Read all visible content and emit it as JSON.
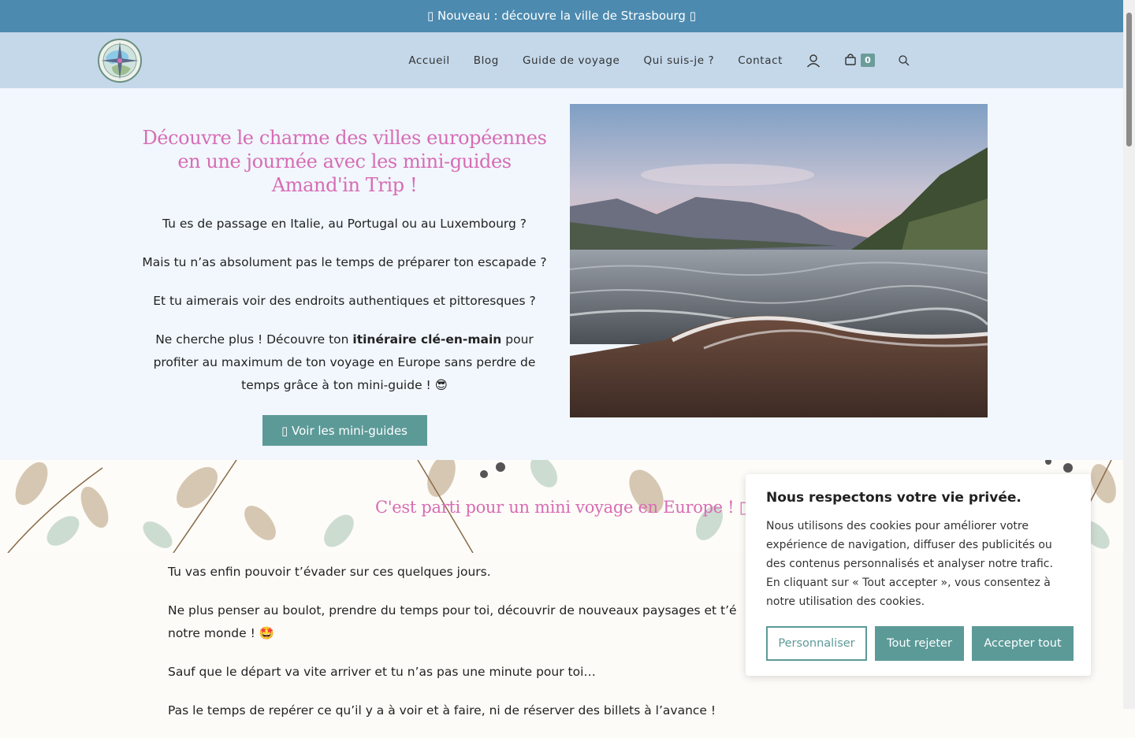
{
  "announcement": "▯ Nouveau : découvre la ville de Strasbourg ▯",
  "nav": {
    "items": [
      {
        "label": "Accueil"
      },
      {
        "label": "Blog"
      },
      {
        "label": "Guide de voyage"
      },
      {
        "label": "Qui suis-je ?"
      },
      {
        "label": "Contact"
      }
    ],
    "icons": [
      "user-icon",
      "cart-icon",
      "search-icon"
    ],
    "cart_count": "0"
  },
  "hero": {
    "title": "Découvre le charme des villes européennes en une journée avec les mini-guides Amand'in Trip !",
    "p1": "Tu es de passage en Italie, au Portugal ou au Luxembourg ?",
    "p2": "Mais tu n’as absolument pas le temps de préparer ton escapade ?",
    "p3": "Et tu aimerais voir des endroits authentiques et pittoresques ?",
    "p4_before": "Ne cherche plus ! Découvre ton ",
    "p4_bold": "itinéraire clé-en-main",
    "p4_after": " pour profiter au maximum de ton voyage en Europe sans perdre de temps grâce à ton mini-guide ! 😎",
    "button": "▯ Voir les mini-guides"
  },
  "section": {
    "title": "C'est parti pour un mini voyage en Europe ! ▯"
  },
  "content": {
    "p1": "Tu vas enfin pouvoir t’évader sur ces quelques jours.",
    "p2": "Ne plus penser au boulot, prendre du temps pour toi, découvrir de nouveaux paysages et t’é",
    "p2b": "notre monde ! 🤩",
    "p3": "Sauf que le départ va vite arriver et tu n’as pas une minute pour toi…",
    "p4": "Pas le temps de repérer ce qu’il y a à voir et à faire, ni de réserver des billets à l’avance !"
  },
  "cookie": {
    "title": "Nous respectons votre vie privée.",
    "text": "Nous utilisons des cookies pour améliorer votre expérience de navigation, diffuser des publicités ou des contenus personnalisés et analyser notre trafic. En cliquant sur « Tout accepter », vous consentez à notre utilisation des cookies.",
    "customize": "Personnaliser",
    "reject": "Tout rejeter",
    "accept": "Accepter tout"
  },
  "colors": {
    "announcement_bg": "#4c8aaf",
    "header_bg": "#c4d8ea",
    "accent_pink": "#d86cb4",
    "button_teal": "#5c9a98"
  }
}
